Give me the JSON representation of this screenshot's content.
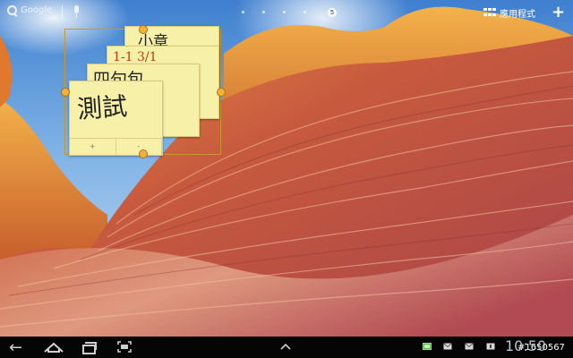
{
  "statusbar": {
    "search_label": "Google",
    "page_number": "5",
    "apps_label": "應用程式"
  },
  "widget": {
    "notes": [
      {
        "text": "小章"
      },
      {
        "text": "1-1 3/1"
      },
      {
        "text": "四句包"
      },
      {
        "text": "測試"
      }
    ],
    "controls": [
      "+",
      "-"
    ]
  },
  "navbar": {
    "clock": "10:50",
    "watermark": "#1650567",
    "icons": [
      "back-icon",
      "home-icon",
      "recent-apps-icon",
      "screenshot-icon",
      "up-arrow-icon",
      "battery-icon",
      "gmail-icon",
      "gmail-icon",
      "calendar-icon"
    ]
  },
  "colors": {
    "sky": "#3f7fcf",
    "sandstone": "#c6583f",
    "note": "#f6f0a8",
    "handle": "#f2b236",
    "navbar": "#050505"
  }
}
